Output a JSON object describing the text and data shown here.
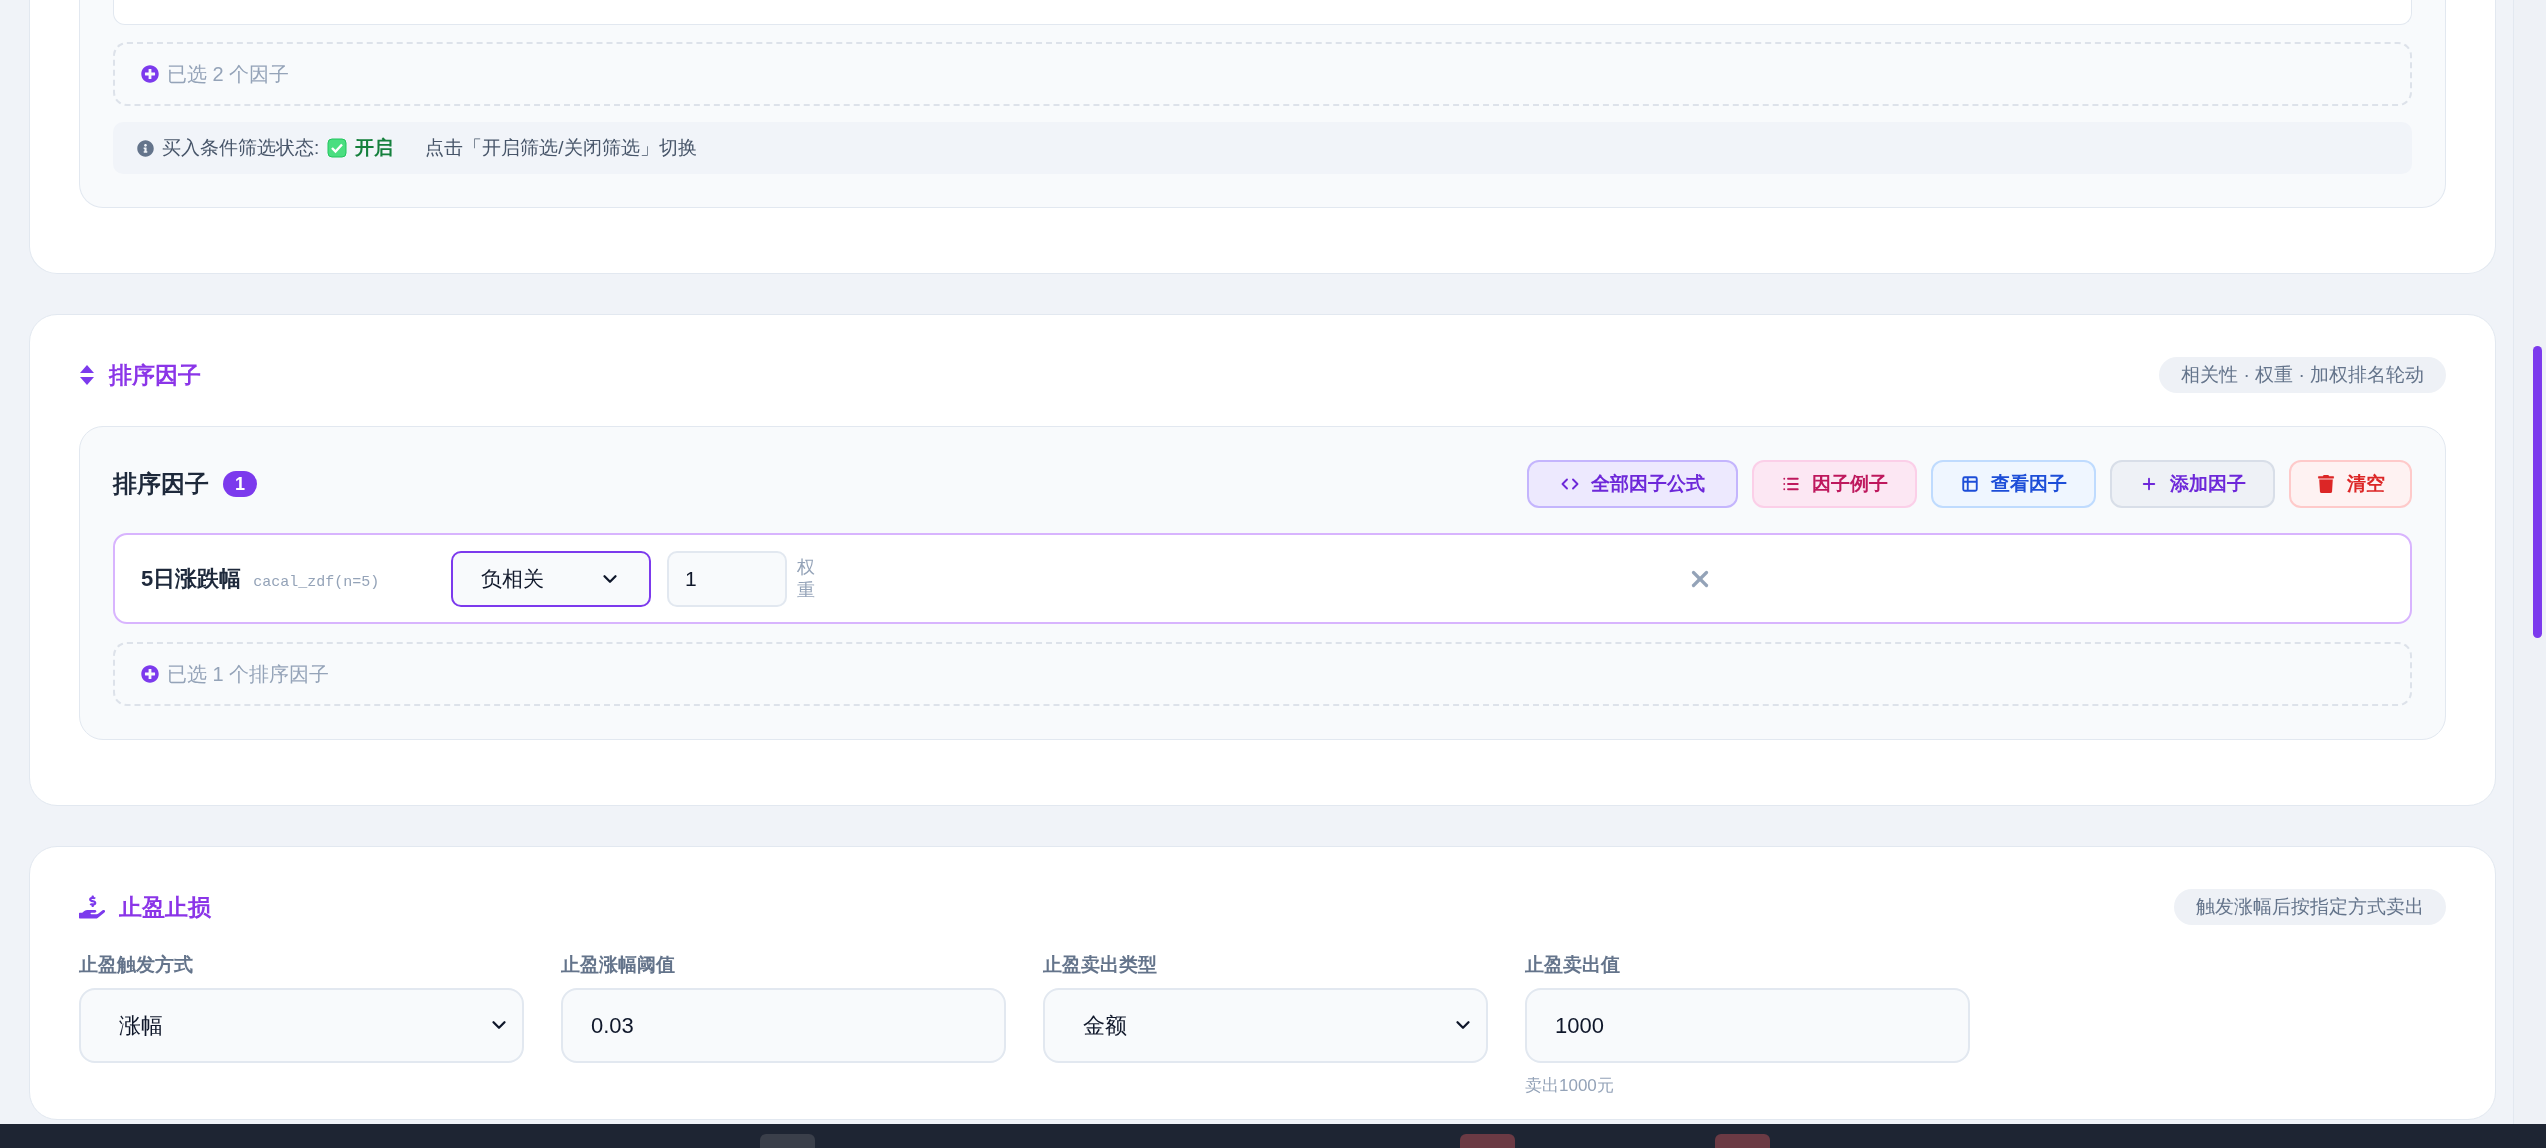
{
  "filter_section": {
    "selected_count": "已选 2 个因子",
    "status": {
      "label": "买入条件筛选状态:",
      "checked": true,
      "value": "开启",
      "hint": "点击「开启筛选/关闭筛选」切换"
    }
  },
  "sort_section": {
    "title": "排序因子",
    "tag": "相关性 · 权重 · 加权排名轮动",
    "panel": {
      "title": "排序因子",
      "count": "1",
      "buttons": [
        {
          "kind": "formula",
          "label": "全部因子公式"
        },
        {
          "kind": "examples",
          "label": "因子例子"
        },
        {
          "kind": "view",
          "label": "查看因子"
        },
        {
          "kind": "add",
          "label": "添加因子"
        },
        {
          "kind": "clear",
          "label": "清空"
        }
      ],
      "factors": [
        {
          "name": "5日涨跌幅",
          "formula": "cacal_zdf(n=5)",
          "correlation": "负相关",
          "weight": "1",
          "weight_label": "权重"
        }
      ],
      "selected_count": "已选 1 个排序因子"
    }
  },
  "take_profit": {
    "title": "止盈止损",
    "tag": "触发涨幅后按指定方式卖出",
    "fields": [
      {
        "kind": "select",
        "label": "止盈触发方式",
        "value": "涨幅"
      },
      {
        "kind": "input",
        "label": "止盈涨幅阈值",
        "value": "0.03"
      },
      {
        "kind": "select",
        "label": "止盈卖出类型",
        "value": "金额"
      },
      {
        "kind": "input",
        "label": "止盈卖出值",
        "value": "1000",
        "hint": "卖出1000元"
      }
    ]
  }
}
